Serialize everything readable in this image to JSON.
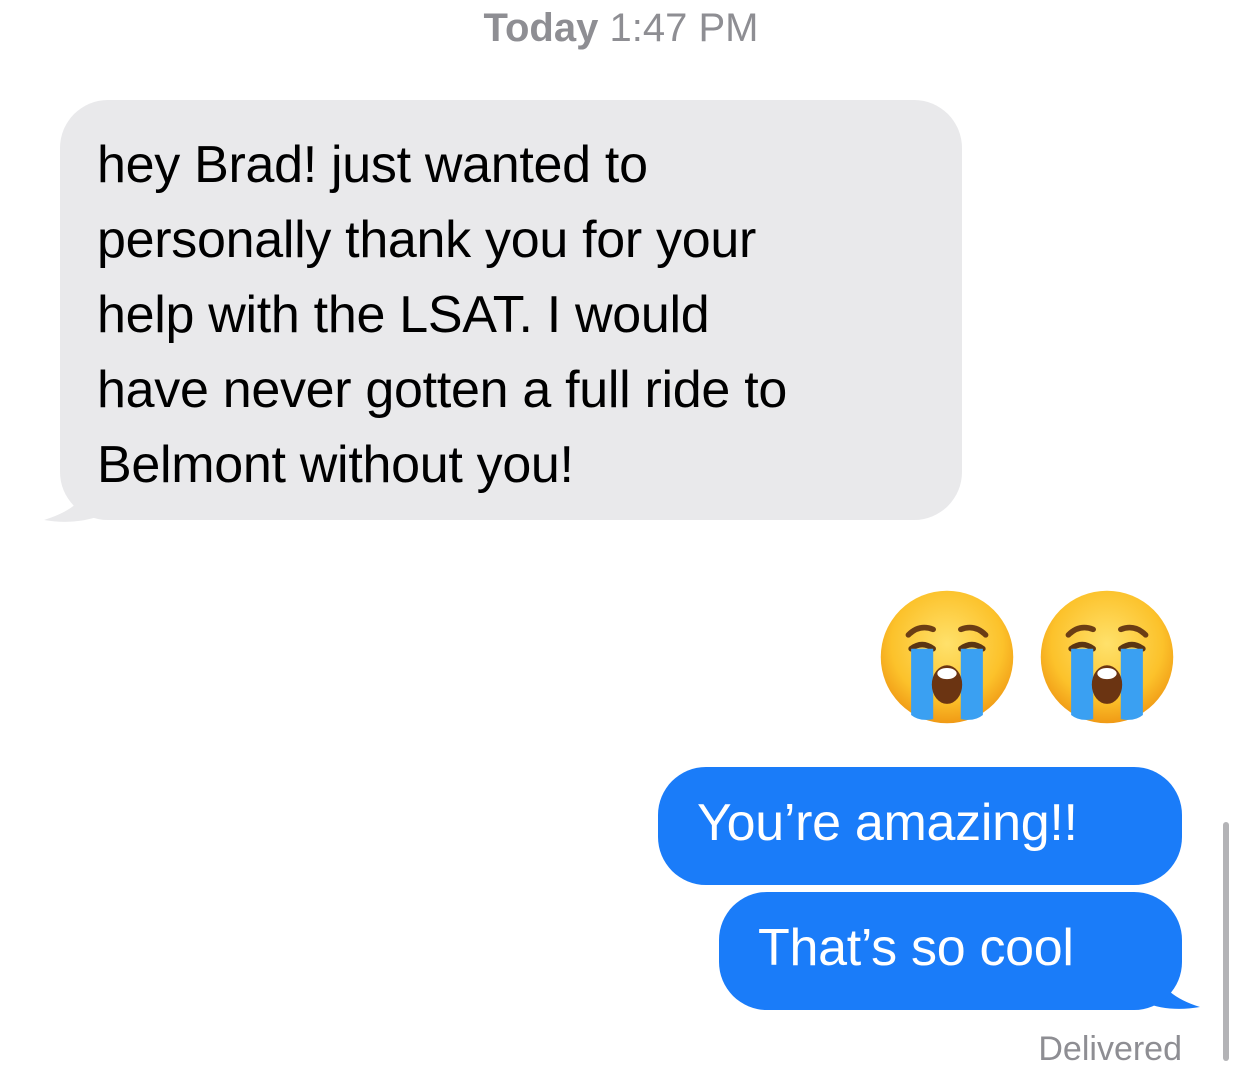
{
  "header": {
    "day": "Today",
    "time": "1:47 PM"
  },
  "messages": {
    "incoming": {
      "lines": [
        "hey Brad! just wanted to",
        "personally thank you for your",
        "help with the LSAT. I would",
        "have never gotten a full ride to",
        "Belmont without you!"
      ]
    },
    "emoji": [
      "loudly-crying-face-icon",
      "loudly-crying-face-icon"
    ],
    "outgoing": [
      {
        "text": "You’re amazing!!"
      },
      {
        "text": "That’s so cool"
      }
    ],
    "status": "Delivered"
  },
  "colors": {
    "incoming_bubble": "#e9e9eb",
    "outgoing_bubble": "#1a7cf9",
    "meta_text": "#8e8e93"
  }
}
